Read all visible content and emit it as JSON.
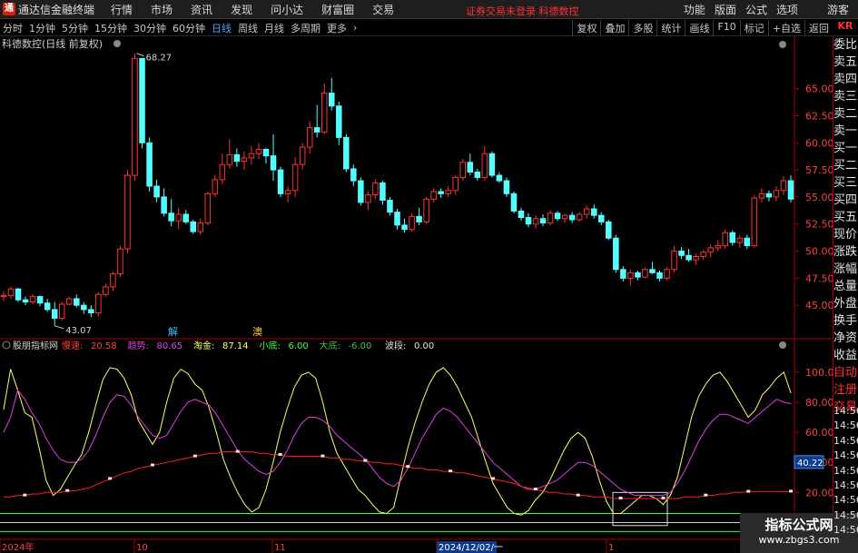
{
  "titlebar": {
    "app_title": "通达信金融终端",
    "menu": [
      "行情",
      "市场",
      "资讯",
      "发现",
      "问小达",
      "财富圈",
      "交易"
    ],
    "broker_status": "证券交易未登录  科德数控",
    "right_menu": [
      "功能",
      "版面",
      "公式",
      "选项",
      "游客"
    ]
  },
  "periods": [
    "分时",
    "1分钟",
    "5分钟",
    "15分钟",
    "30分钟",
    "60分钟",
    "日线",
    "周线",
    "月线",
    "多周期",
    "更多"
  ],
  "active_period": "日线",
  "toolbar": [
    "复权",
    "叠加",
    "多股",
    "统计",
    "画线",
    "F10",
    "标记",
    "+自选",
    "返回"
  ],
  "kr_label": "KR",
  "stock_title": "科德数控(日线 前复权)",
  "quote_labels": [
    "委比",
    "卖五",
    "卖四",
    "卖三",
    "卖二",
    "卖一",
    "买一",
    "买二",
    "买三",
    "买四",
    "买五",
    "现价",
    "涨跌",
    "涨幅",
    "总量",
    "外盘",
    "换手",
    "净资",
    "收益"
  ],
  "right_labels2": [
    "自动",
    "注册",
    "交易"
  ],
  "time_labels": [
    "14:56",
    "14:56",
    "14:56",
    "14:56",
    "14:56",
    "14:56",
    "14:56",
    "14:56",
    "14:56"
  ],
  "price_axis": [
    "65.00",
    "62.50",
    "60.00",
    "57.50",
    "55.00",
    "52.50",
    "50.00",
    "47.50",
    "45.00"
  ],
  "indicator_axis": [
    "100.0",
    "80.00",
    "60.00",
    "40.00",
    "20.00"
  ],
  "current_marker": "40.22",
  "high_label": "68.27",
  "low_label": "43.07",
  "signal_labels": {
    "jie": "解",
    "jin": "澳"
  },
  "indicator": {
    "name": "股朋指标网",
    "items": [
      {
        "label": "慢速:",
        "value": "20.58",
        "color": "#ff4040"
      },
      {
        "label": "趋势:",
        "value": "80.65",
        "color": "#e040e0"
      },
      {
        "label": "淘金:",
        "value": "87.14",
        "color": "#ffff60"
      },
      {
        "label": "小底:",
        "value": "6.00",
        "color": "#40ff40"
      },
      {
        "label": "大底:",
        "value": "-6.00",
        "color": "#40c040"
      },
      {
        "label": "波段:",
        "value": "0.00",
        "color": "#e0e0e0"
      }
    ]
  },
  "date_axis": [
    "2024年",
    "10",
    "11",
    "2024/12/02/一",
    "1"
  ],
  "watermark": {
    "title": "指标公式网",
    "url": "www.zbgs3.com"
  },
  "chart_data": {
    "type": "candlestick",
    "ylim": [
      43,
      69
    ],
    "candles": [
      [
        45.8,
        46.3,
        45.4,
        45.9
      ],
      [
        45.9,
        46.7,
        45.6,
        46.5
      ],
      [
        46.5,
        46.6,
        45.3,
        45.5
      ],
      [
        45.5,
        45.8,
        45.0,
        45.3
      ],
      [
        45.3,
        46.0,
        45.1,
        45.8
      ],
      [
        45.8,
        45.9,
        44.9,
        45.2
      ],
      [
        45.2,
        45.6,
        44.4,
        44.6
      ],
      [
        44.6,
        45.3,
        43.1,
        43.8
      ],
      [
        43.8,
        45.3,
        43.6,
        45.1
      ],
      [
        45.1,
        45.8,
        45.0,
        45.6
      ],
      [
        45.6,
        46.0,
        44.8,
        45.0
      ],
      [
        45.0,
        45.3,
        44.2,
        44.6
      ],
      [
        44.6,
        45.0,
        43.9,
        44.3
      ],
      [
        44.3,
        46.2,
        44.0,
        46.0
      ],
      [
        46.0,
        47.0,
        45.8,
        46.7
      ],
      [
        46.7,
        48.1,
        46.3,
        47.9
      ],
      [
        47.9,
        50.5,
        47.6,
        50.2
      ],
      [
        50.2,
        57.5,
        49.8,
        57.0
      ],
      [
        57.0,
        68.27,
        56.5,
        67.8
      ],
      [
        67.8,
        61.0,
        59.5,
        60.0
      ],
      [
        60.0,
        60.5,
        55.5,
        56.0
      ],
      [
        56.0,
        56.6,
        54.5,
        55.0
      ],
      [
        55.0,
        55.8,
        53.2,
        53.5
      ],
      [
        53.5,
        54.8,
        52.3,
        52.8
      ],
      [
        52.8,
        54.0,
        52.0,
        53.4
      ],
      [
        53.4,
        53.8,
        52.5,
        52.7
      ],
      [
        52.7,
        52.9,
        51.6,
        51.8
      ],
      [
        51.8,
        53.0,
        51.5,
        52.6
      ],
      [
        52.6,
        55.5,
        52.4,
        55.3
      ],
      [
        55.3,
        57.0,
        55.0,
        56.6
      ],
      [
        56.6,
        59.0,
        56.2,
        58.0
      ],
      [
        58.0,
        60.3,
        57.6,
        58.9
      ],
      [
        58.9,
        59.5,
        57.8,
        58.3
      ],
      [
        58.3,
        59.2,
        57.5,
        58.6
      ],
      [
        58.6,
        59.7,
        58.0,
        59.0
      ],
      [
        59.0,
        60.0,
        58.5,
        59.4
      ],
      [
        59.4,
        59.5,
        58.1,
        58.8
      ],
      [
        58.8,
        60.8,
        56.5,
        57.5
      ],
      [
        57.5,
        57.8,
        55.0,
        55.3
      ],
      [
        55.3,
        56.0,
        54.5,
        55.6
      ],
      [
        55.6,
        58.7,
        55.0,
        58.0
      ],
      [
        58.0,
        60.0,
        57.5,
        59.6
      ],
      [
        59.6,
        62.0,
        59.0,
        61.4
      ],
      [
        61.4,
        63.5,
        60.5,
        61.0
      ],
      [
        61.0,
        65.5,
        60.8,
        64.6
      ],
      [
        64.6,
        66.0,
        63.0,
        63.4
      ],
      [
        63.4,
        63.8,
        59.8,
        60.5
      ],
      [
        60.5,
        60.8,
        57.3,
        57.6
      ],
      [
        57.6,
        58.0,
        56.0,
        56.5
      ],
      [
        56.5,
        56.8,
        54.2,
        54.5
      ],
      [
        54.5,
        55.5,
        53.8,
        55.2
      ],
      [
        55.2,
        56.6,
        54.8,
        56.3
      ],
      [
        56.3,
        56.5,
        54.3,
        54.7
      ],
      [
        54.7,
        55.0,
        53.3,
        53.6
      ],
      [
        53.6,
        53.9,
        52.0,
        52.4
      ],
      [
        52.4,
        53.0,
        51.7,
        52.0
      ],
      [
        52.0,
        53.5,
        51.8,
        53.2
      ],
      [
        53.2,
        54.0,
        52.4,
        52.7
      ],
      [
        52.7,
        55.0,
        52.5,
        54.8
      ],
      [
        54.8,
        55.8,
        54.5,
        55.5
      ],
      [
        55.5,
        55.8,
        54.9,
        55.3
      ],
      [
        55.3,
        56.0,
        55.0,
        55.6
      ],
      [
        55.6,
        57.0,
        55.2,
        56.8
      ],
      [
        56.8,
        58.5,
        56.5,
        58.2
      ],
      [
        58.2,
        59.0,
        57.0,
        57.3
      ],
      [
        57.3,
        57.6,
        56.5,
        56.8
      ],
      [
        56.8,
        59.7,
        56.5,
        59.0
      ],
      [
        59.0,
        59.2,
        56.8,
        57.0
      ],
      [
        57.0,
        57.3,
        56.3,
        56.5
      ],
      [
        56.5,
        56.8,
        55.0,
        55.3
      ],
      [
        55.3,
        55.5,
        53.5,
        53.7
      ],
      [
        53.7,
        54.0,
        52.8,
        53.1
      ],
      [
        53.1,
        53.5,
        52.2,
        52.5
      ],
      [
        52.5,
        53.3,
        52.1,
        53.0
      ],
      [
        53.0,
        53.4,
        52.3,
        52.6
      ],
      [
        52.6,
        53.8,
        52.4,
        53.5
      ],
      [
        53.5,
        53.7,
        52.8,
        53.0
      ],
      [
        53.0,
        53.5,
        52.6,
        53.3
      ],
      [
        53.3,
        53.6,
        52.6,
        52.9
      ],
      [
        52.9,
        53.6,
        52.7,
        53.4
      ],
      [
        53.4,
        54.2,
        53.0,
        53.9
      ],
      [
        53.9,
        54.3,
        53.0,
        53.3
      ],
      [
        53.3,
        53.6,
        52.4,
        52.7
      ],
      [
        52.7,
        52.9,
        51.0,
        51.2
      ],
      [
        51.2,
        51.5,
        48.0,
        48.3
      ],
      [
        48.3,
        48.6,
        47.2,
        47.5
      ],
      [
        47.5,
        48.3,
        46.8,
        48.0
      ],
      [
        48.0,
        48.2,
        47.3,
        47.6
      ],
      [
        47.6,
        48.5,
        47.5,
        48.3
      ],
      [
        48.3,
        49.0,
        47.9,
        48.0
      ],
      [
        48.0,
        48.2,
        47.2,
        47.5
      ],
      [
        47.5,
        48.5,
        47.3,
        48.3
      ],
      [
        48.3,
        50.5,
        48.0,
        50.0
      ],
      [
        50.0,
        50.4,
        49.3,
        49.6
      ],
      [
        49.6,
        50.2,
        49.0,
        49.2
      ],
      [
        49.2,
        49.8,
        48.7,
        49.5
      ],
      [
        49.5,
        50.1,
        49.2,
        49.9
      ],
      [
        49.9,
        50.6,
        49.4,
        50.3
      ],
      [
        50.3,
        51.0,
        50.0,
        50.5
      ],
      [
        50.5,
        52.0,
        50.2,
        51.7
      ],
      [
        51.7,
        51.9,
        50.5,
        50.8
      ],
      [
        50.8,
        51.5,
        50.3,
        51.2
      ],
      [
        51.2,
        51.5,
        50.2,
        50.5
      ],
      [
        50.5,
        55.2,
        50.3,
        54.9
      ],
      [
        54.9,
        55.8,
        54.5,
        55.3
      ],
      [
        55.3,
        55.6,
        54.6,
        55.0
      ],
      [
        55.0,
        56.0,
        54.6,
        55.6
      ],
      [
        55.6,
        56.9,
        55.2,
        56.5
      ],
      [
        56.5,
        57.0,
        54.5,
        54.8
      ]
    ],
    "indicator_series": {
      "淘金": [
        75,
        102,
        88,
        73,
        70,
        50,
        28,
        18,
        22,
        30,
        38,
        45,
        60,
        78,
        95,
        103,
        102,
        96,
        85,
        68,
        60,
        52,
        60,
        80,
        96,
        102,
        99,
        92,
        88,
        76,
        60,
        42,
        30,
        20,
        12,
        7,
        10,
        22,
        40,
        60,
        76,
        90,
        98,
        100,
        96,
        80,
        60,
        46,
        38,
        30,
        22,
        18,
        12,
        7,
        6,
        10,
        30,
        50,
        66,
        80,
        92,
        100,
        103,
        98,
        90,
        80,
        70,
        55,
        40,
        26,
        18,
        10,
        6,
        5,
        8,
        15,
        20,
        28,
        38,
        48,
        56,
        60,
        56,
        44,
        28,
        14,
        6,
        6,
        10,
        14,
        18,
        18,
        16,
        12,
        18,
        30,
        50,
        70,
        84,
        92,
        98,
        100,
        94,
        86,
        78,
        70,
        75,
        85,
        90,
        96,
        100,
        86
      ],
      "趋势": [
        60,
        70,
        88,
        82,
        73,
        66,
        56,
        48,
        42,
        40,
        40,
        42,
        48,
        58,
        70,
        80,
        85,
        84,
        78,
        70,
        64,
        58,
        56,
        58,
        66,
        74,
        80,
        82,
        80,
        78,
        72,
        64,
        56,
        48,
        42,
        38,
        34,
        32,
        34,
        40,
        48,
        58,
        66,
        70,
        70,
        68,
        64,
        58,
        54,
        50,
        46,
        42,
        36,
        30,
        26,
        24,
        28,
        36,
        46,
        56,
        64,
        72,
        76,
        74,
        70,
        64,
        58,
        52,
        46,
        40,
        36,
        32,
        28,
        24,
        22,
        22,
        24,
        26,
        28,
        32,
        36,
        40,
        40,
        38,
        34,
        30,
        26,
        22,
        20,
        18,
        18,
        18,
        18,
        18,
        20,
        26,
        34,
        44,
        54,
        62,
        68,
        72,
        72,
        70,
        68,
        66,
        70,
        74,
        78,
        82,
        80,
        79
      ],
      "慢速": [
        17,
        17,
        18,
        18,
        19,
        19,
        20,
        20,
        20,
        21,
        21,
        22,
        23,
        25,
        27,
        29,
        31,
        33,
        34,
        36,
        37,
        38,
        39,
        40,
        41,
        42,
        43,
        44,
        45,
        46,
        46,
        47,
        47,
        47,
        47,
        47,
        46,
        46,
        45,
        45,
        44,
        44,
        44,
        44,
        44,
        44,
        43,
        43,
        42,
        42,
        41,
        41,
        40,
        40,
        39,
        39,
        38,
        37,
        36,
        36,
        35,
        35,
        34,
        34,
        33,
        33,
        32,
        31,
        30,
        29,
        28,
        27,
        26,
        24,
        23,
        22,
        21,
        20,
        20,
        19,
        19,
        18,
        18,
        17,
        17,
        17,
        16,
        16,
        16,
        16,
        16,
        16,
        16,
        16,
        16,
        16,
        17,
        17,
        17,
        18,
        18,
        19,
        19,
        20,
        20,
        20.5,
        20.6,
        20.6,
        20.6,
        20.6,
        20.58,
        20.58
      ]
    }
  }
}
